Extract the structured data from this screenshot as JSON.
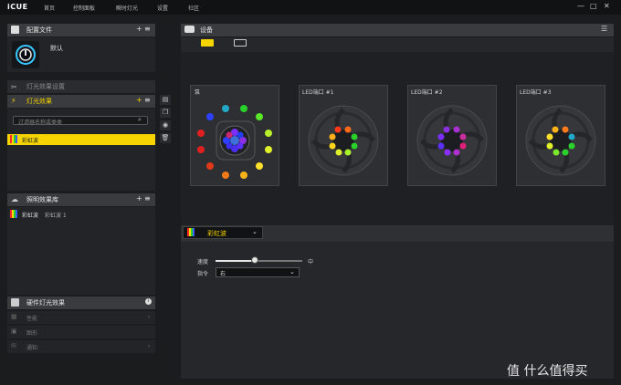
{
  "app": {
    "logo": "iCUE",
    "nav": [
      "首页",
      "控制面板",
      "瞬时灯光",
      "设置",
      "社区"
    ],
    "window_controls": [
      "—",
      "□",
      "✕"
    ]
  },
  "sidebar": {
    "profiles": {
      "title": "配置文件",
      "default_profile": "默认"
    },
    "lighting_settings": "灯光效果设置",
    "effects": {
      "title": "灯光效果",
      "search_placeholder": "过滤器名称或类类",
      "selected_effect": "彩虹波"
    },
    "library": {
      "title": "照明效果库",
      "item_name": "彩虹波",
      "item_extra": "彩虹波 1"
    },
    "hardware": {
      "title": "硬件灯光效果",
      "items": [
        "性能",
        "图形",
        "通知"
      ]
    }
  },
  "devices": {
    "title": "设备",
    "cards": [
      {
        "title": "泵"
      },
      {
        "title": "LED端口 #1"
      },
      {
        "title": "LED端口 #2"
      },
      {
        "title": "LED端口 #3"
      }
    ]
  },
  "effect_panel": {
    "effect": "彩虹波",
    "speed_label": "速度",
    "speed_value_label": "中",
    "speed_level": 0.45,
    "direction_label": "指令",
    "direction_value": "右"
  },
  "watermark": "值 什么值得买"
}
